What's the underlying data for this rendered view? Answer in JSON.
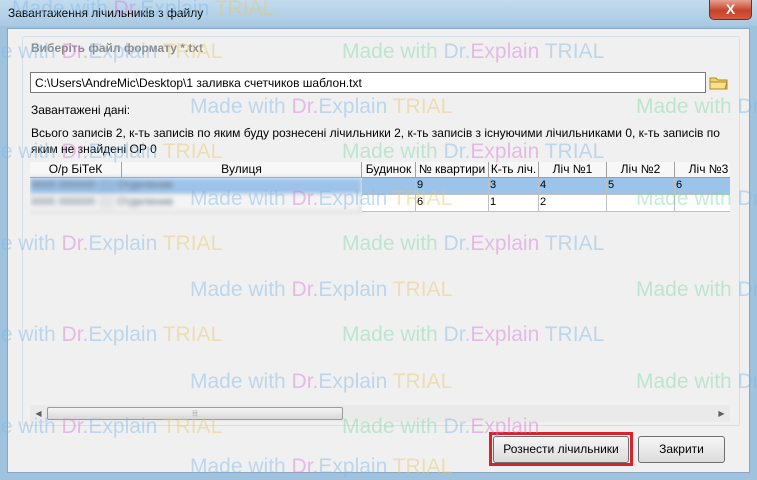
{
  "window": {
    "title": "Завантаження лічильників з файлу",
    "close_label": "X"
  },
  "file": {
    "group_label": "Виберіть файл формату *.txt",
    "path": "C:\\Users\\AndreMic\\Desktop\\1 заливка счетчиков шаблон.txt",
    "browse_icon": "folder-icon"
  },
  "loaded": {
    "label": "Завантажені дані:",
    "summary": "Всього записів 2, к-ть записів по яким буду рознесені лічильники 2, к-ть записів з існуючими лічильниками 0, к-ть записів по яким не знайдені ОР 0"
  },
  "table": {
    "columns": [
      "О/р БіТеК",
      "Вулиця",
      "Будинок",
      "№ квартири",
      "К-ть ліч.",
      "Ліч №1",
      "Ліч №2",
      "Ліч №3"
    ],
    "rows": [
      {
        "account": "0000 000000 ░░ Отделение",
        "street": "",
        "house": "",
        "apartment": "9",
        "meter_count": "3",
        "m1": "4",
        "m2": "5",
        "m3": "6",
        "selected": true
      },
      {
        "account": "0000 000000 ░░ Отделение",
        "street": "",
        "house": "",
        "apartment": "6",
        "meter_count": "1",
        "m1": "2",
        "m2": "",
        "m3": "",
        "selected": false
      }
    ]
  },
  "scrollbar": {
    "left_arrow": "◀",
    "right_arrow": "▶",
    "thumb_grip": "⦙⦙⦙"
  },
  "buttons": {
    "distribute": "Рознести лічильники",
    "close": "Закрити"
  },
  "watermark": {
    "p1": "Made with ",
    "p2": "Dr.",
    "p3": "Explain ",
    "p4": "TRIAL"
  },
  "colors": {
    "selection": "#9cc4ea",
    "highlight_frame": "#d8232a",
    "close_button": "#c7432b"
  }
}
